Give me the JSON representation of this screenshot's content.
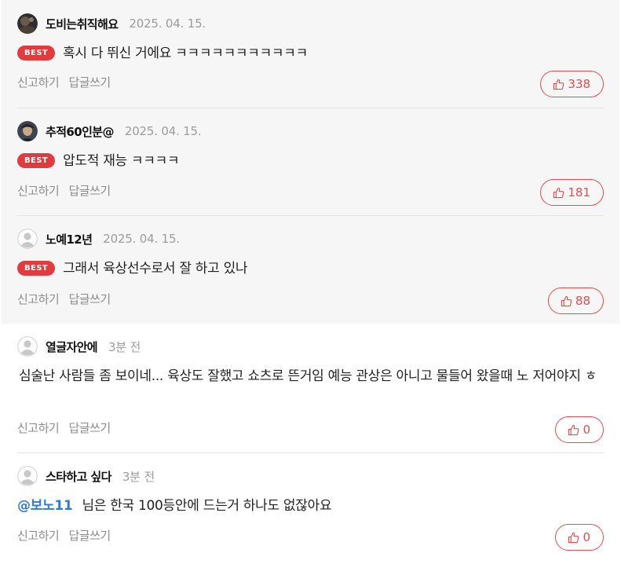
{
  "comments": [
    {
      "author": "도비는취직해요",
      "date": "2025. 04. 15.",
      "best_label": "BEST",
      "text": "혹시 다 뛰신 거에요 ㅋㅋㅋㅋㅋㅋㅋㅋㅋㅋㅋ",
      "report_label": "신고하기",
      "reply_label": "답글쓰기",
      "likes": "338",
      "avatar": "photo-avatar-dark"
    },
    {
      "author": "추적60인분@",
      "date": "2025. 04. 15.",
      "best_label": "BEST",
      "text": "압도적 재능 ㅋㅋㅋㅋ",
      "report_label": "신고하기",
      "reply_label": "답글쓰기",
      "likes": "181",
      "avatar": "photo-avatar-face"
    },
    {
      "author": "노예12년",
      "date": "2025. 04. 15.",
      "best_label": "BEST",
      "text": "그래서 육상선수로서 잘 하고 있나",
      "report_label": "신고하기",
      "reply_label": "답글쓰기",
      "likes": "88",
      "avatar": "default-user-avatar"
    },
    {
      "author": "열글자안에",
      "date": "3분 전",
      "text": " 심술난 사람들 좀 보이네... 육상도 잘했고 쇼츠로 뜬거임 예능 관상은 아니고 물들어 왔을때 노 저어야지 ㅎ",
      "report_label": "신고하기",
      "reply_label": "답글쓰기",
      "likes": "0",
      "avatar": "default-user-avatar"
    },
    {
      "author": "스타하고 싶다",
      "date": "3분 전",
      "mention": "@보노11",
      "text": "님은 한국 100등안에 드는거 하나도 없잖아요",
      "report_label": "신고하기",
      "reply_label": "답글쓰기",
      "likes": "0",
      "avatar": "default-user-avatar"
    }
  ],
  "icons": {
    "like": "thumbs-up-icon"
  },
  "colors": {
    "best_badge": "#e03b3e",
    "like_accent": "#e54c4c",
    "mention": "#2f7bd9",
    "best_background": "#f6f6f6"
  }
}
